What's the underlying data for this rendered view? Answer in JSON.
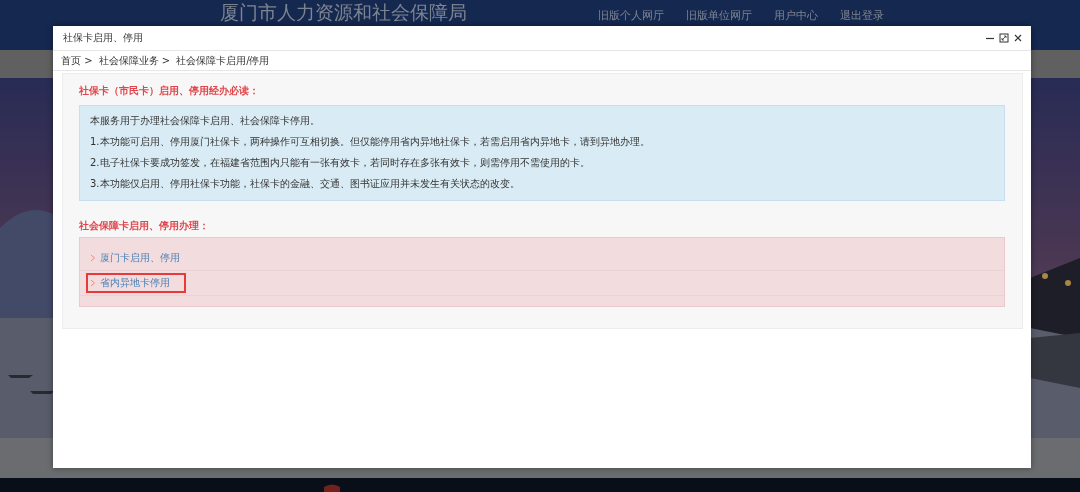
{
  "site": {
    "title": "厦门市人力资源和社会保障局",
    "nav": [
      "旧版个人网厅",
      "旧版单位网厅",
      "用户中心",
      "退出登录"
    ]
  },
  "dialog": {
    "title": "社保卡启用、停用",
    "breadcrumb": [
      "首页 >",
      "社会保障业务 >",
      "社会保障卡启用/停用"
    ],
    "notice": {
      "heading": "社保卡（市民卡）启用、停用经办必读：",
      "paragraphs": [
        "本服务用于办理社会保障卡启用、社会保障卡停用。",
        "1.本功能可启用、停用厦门社保卡，两种操作可互相切换。但仅能停用省内异地社保卡，若需启用省内异地卡，请到异地办理。",
        "2.电子社保卡要成功签发，在福建省范围内只能有一张有效卡，若同时存在多张有效卡，则需停用不需使用的卡。",
        "3.本功能仅启用、停用社保卡功能，社保卡的金融、交通、图书证应用并未发生有关状态的改变。"
      ]
    },
    "services": {
      "heading": "社会保障卡启用、停用办理：",
      "links": [
        {
          "label": "厦门卡启用、停用",
          "highlighted": false
        },
        {
          "label": "省内异地卡停用",
          "highlighted": true
        }
      ]
    }
  }
}
